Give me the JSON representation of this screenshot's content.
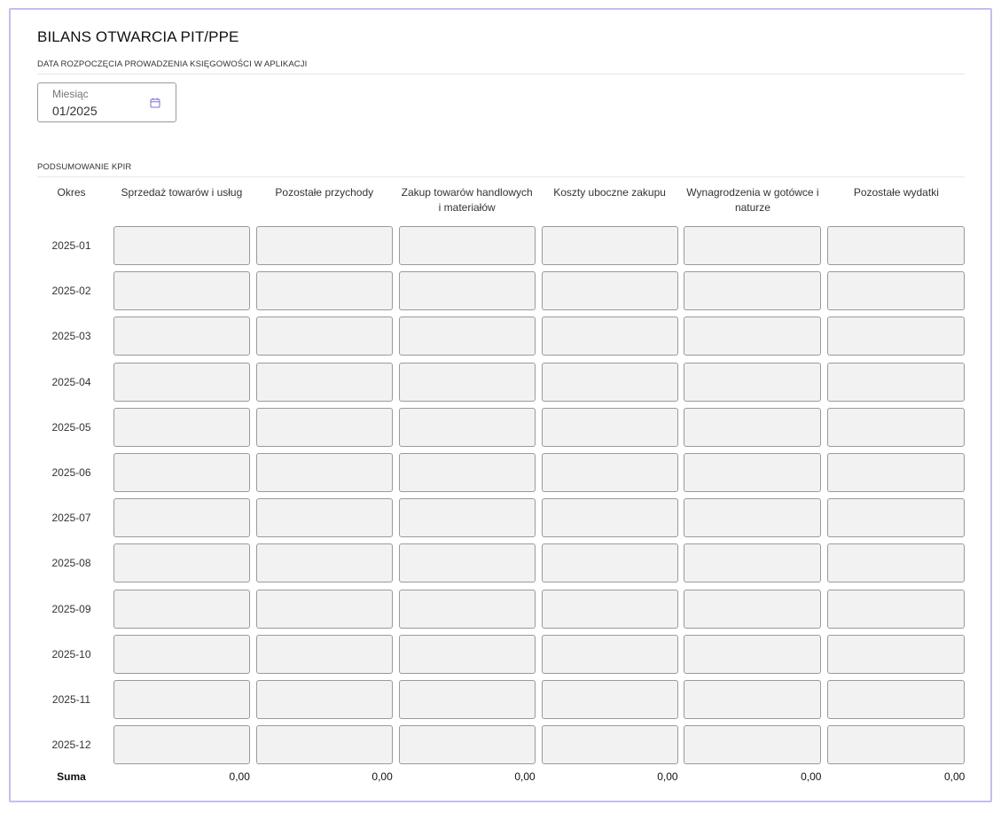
{
  "title": "BILANS OTWARCIA PIT/PPE",
  "start_section": {
    "label": "DATA ROZPOCZĘCIA PROWADZENIA KSIĘGOWOŚCI W APLIKACJI",
    "month_field": {
      "label": "Miesiąc",
      "value": "01/2025",
      "icon": "calendar-icon"
    }
  },
  "summary_section": {
    "label": "PODSUMOWANIE KPIR",
    "columns": [
      "Okres",
      "Sprzedaż towarów i usług",
      "Pozostałe przychody",
      "Zakup towarów handlowych i materiałów",
      "Koszty uboczne zakupu",
      "Wynagrodzenia w gotówce i naturze",
      "Pozostałe wydatki"
    ],
    "periods": [
      "2025-01",
      "2025-02",
      "2025-03",
      "2025-04",
      "2025-05",
      "2025-06",
      "2025-07",
      "2025-08",
      "2025-09",
      "2025-10",
      "2025-11",
      "2025-12"
    ],
    "sum_label": "Suma",
    "sums": [
      "0,00",
      "0,00",
      "0,00",
      "0,00",
      "0,00",
      "0,00"
    ]
  },
  "colors": {
    "frame_border": "#c4bdf0",
    "input_bg": "#f2f2f2",
    "input_border": "#9a9a9a",
    "accent": "#7b6fd0"
  }
}
